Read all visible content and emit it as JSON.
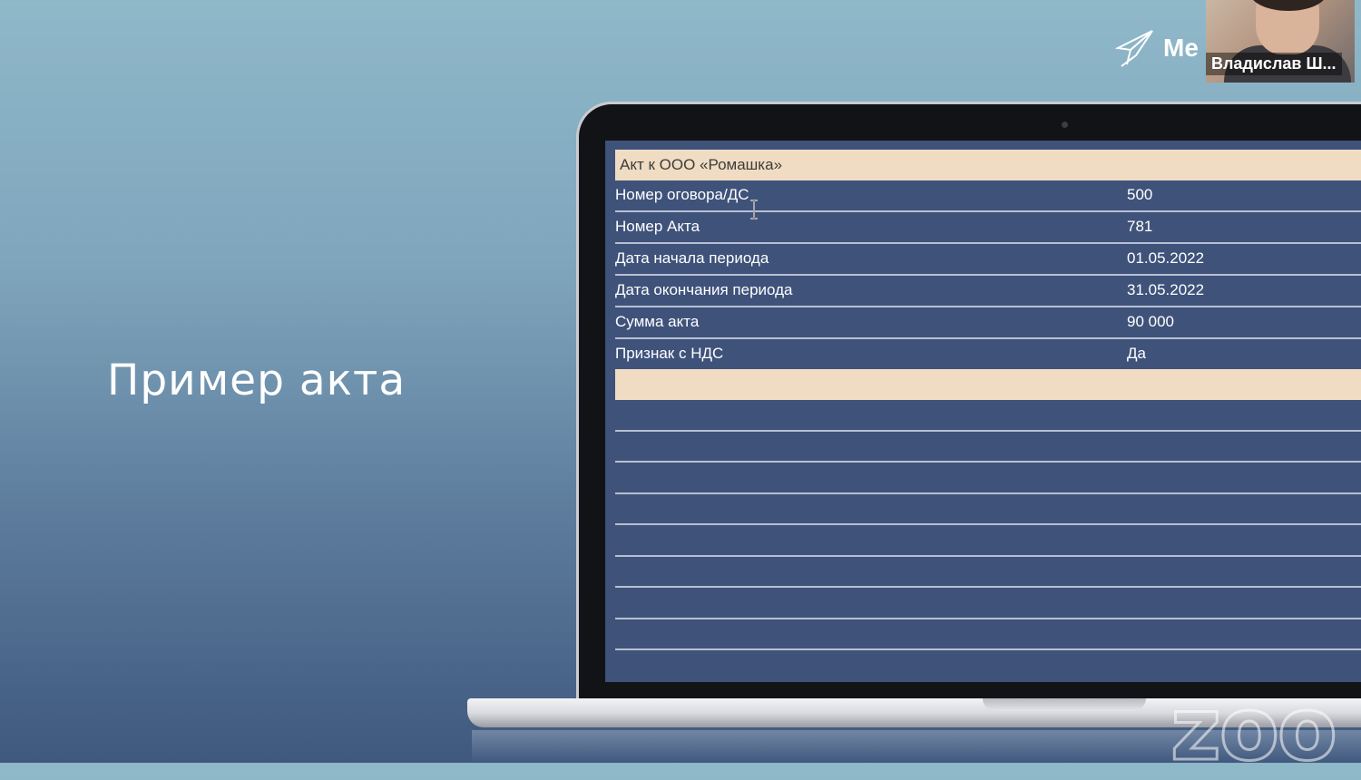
{
  "slide": {
    "title": "Пример акта"
  },
  "logo": {
    "text": "Ме"
  },
  "webcam": {
    "participant_name": "Владислав Ш..."
  },
  "act_table": {
    "header": "Акт к ООО «Ромашка»",
    "rows": [
      {
        "label": "Номер оговора/ДС",
        "value": "500"
      },
      {
        "label": "Номер Акта",
        "value": "781"
      },
      {
        "label": "Дата начала периода",
        "value": "01.05.2022"
      },
      {
        "label": "Дата окончания периода",
        "value": "31.05.2022"
      },
      {
        "label": "Сумма акта",
        "value": "90 000"
      },
      {
        "label": "Признак с НДС",
        "value": "Да"
      }
    ]
  },
  "watermark": {
    "text": "zoo"
  },
  "colors": {
    "screen_bg": "#3f527a",
    "header_bg": "#f0dcc3",
    "row_line": "#b7c0d2"
  }
}
